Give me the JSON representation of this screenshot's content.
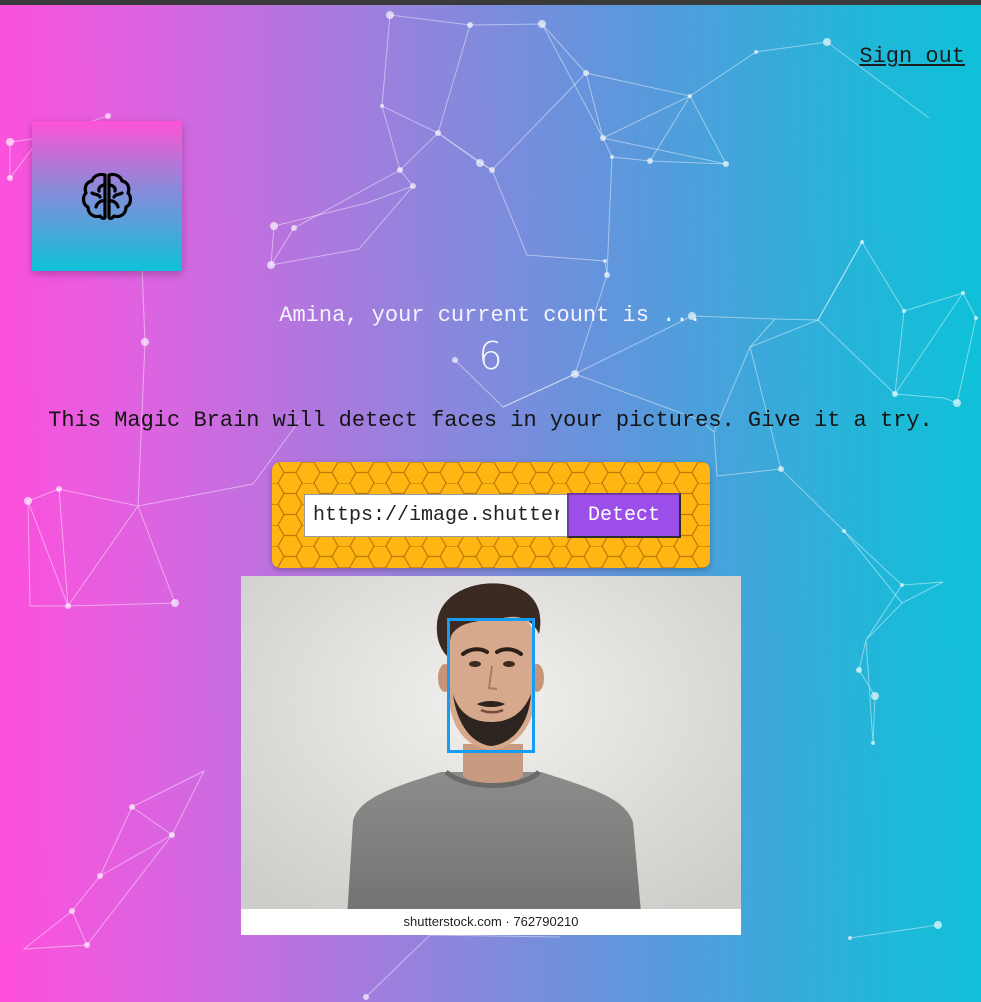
{
  "header": {
    "signout_label": "Sign out"
  },
  "logo": {
    "icon": "brain-icon"
  },
  "rank": {
    "text": "Amina, your current count is ...",
    "count": "6"
  },
  "description": "This Magic Brain will detect faces in your pictures. Give it a try.",
  "image_form": {
    "url_value": "https://image.shutterstock.com/image-photo/",
    "detect_label": "Detect"
  },
  "result_image": {
    "watermark": "shutterstock.com · 762790210",
    "faces_detected": 1
  },
  "colors": {
    "gradient_left": "#ff4fdc",
    "gradient_right": "#0ec1d8",
    "form_background": "#ffb612",
    "detect_button": "#9b4ee9",
    "face_box": "#149df2"
  }
}
